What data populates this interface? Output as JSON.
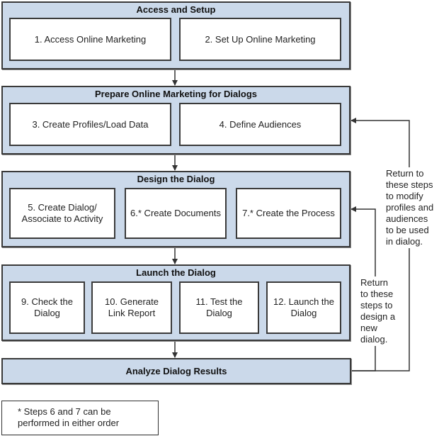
{
  "stages": [
    {
      "title": "Access and Setup",
      "steps": [
        "1. Access Online Marketing",
        "2. Set Up Online Marketing"
      ]
    },
    {
      "title": "Prepare Online Marketing for Dialogs",
      "steps": [
        "3. Create Profiles/Load Data",
        "4. Define Audiences"
      ]
    },
    {
      "title": "Design the Dialog",
      "steps": [
        "5. Create Dialog/ Associate to Activity",
        "6.* Create Documents",
        "7.* Create the Process"
      ]
    },
    {
      "title": "Launch the Dialog",
      "steps": [
        "9. Check the Dialog",
        "10. Generate Link Report",
        "11. Test the Dialog",
        "12. Launch the Dialog"
      ]
    },
    {
      "title": "Analyze Dialog Results",
      "steps": []
    }
  ],
  "loop_notes": {
    "profiles": "Return to these steps to modify profiles and audiences to be used in dialog.",
    "design": "Return to these steps to design a new dialog."
  },
  "footnote": "* Steps 6 and 7 can be performed in either order",
  "colors": {
    "stage_fill": "#cbd9ea",
    "border": "#3a3a3a",
    "step_fill": "#ffffff"
  }
}
